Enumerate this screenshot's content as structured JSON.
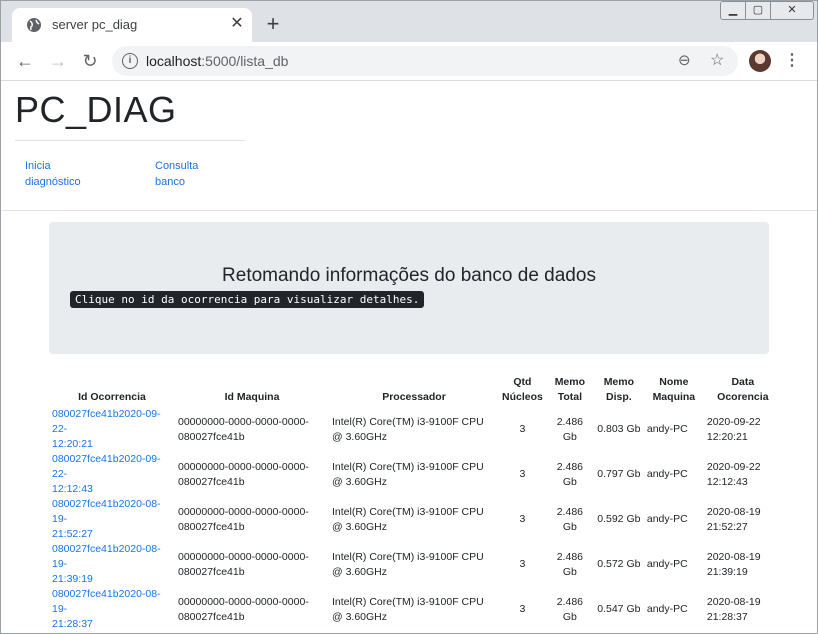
{
  "browser": {
    "tab_title": "server pc_diag",
    "new_tab_label": "+",
    "close_tab_label": "✕",
    "url_host": "localhost",
    "url_path": ":5000/lista_db"
  },
  "header": {
    "brand": "PC_DIAG",
    "nav": [
      {
        "label_1": "Inicia",
        "label_2": "diagnóstico"
      },
      {
        "label_1": "Consulta",
        "label_2": "banco"
      }
    ]
  },
  "jumbotron": {
    "title": "Retomando informações do banco de dados",
    "hint": "Clique no id da ocorrencia para visualizar detalhes."
  },
  "table": {
    "headers": [
      {
        "l1": "Id Ocorrencia",
        "l2": ""
      },
      {
        "l1": "Id Maquina",
        "l2": ""
      },
      {
        "l1": "Processador",
        "l2": ""
      },
      {
        "l1": "Qtd",
        "l2": "Núcleos"
      },
      {
        "l1": "Memo",
        "l2": "Total"
      },
      {
        "l1": "Memo",
        "l2": "Disp."
      },
      {
        "l1": "Nome",
        "l2": "Maquina"
      },
      {
        "l1": "Data",
        "l2": "Ocorencia"
      }
    ],
    "rows": [
      {
        "id1": "080027fce41b2020-09-22-",
        "id2": "12:20:21",
        "maq1": "00000000-0000-0000-0000-",
        "maq2": "080027fce41b",
        "proc1": "Intel(R) Core(TM) i3-9100F CPU",
        "proc2": "@ 3.60GHz",
        "cores": "3",
        "mem_total": "2.486 Gb",
        "mem_disp": "0.803 Gb",
        "nome": "andy-PC",
        "data1": "2020-09-22",
        "data2": "12:20:21"
      },
      {
        "id1": "080027fce41b2020-09-22-",
        "id2": "12:12:43",
        "maq1": "00000000-0000-0000-0000-",
        "maq2": "080027fce41b",
        "proc1": "Intel(R) Core(TM) i3-9100F CPU",
        "proc2": "@ 3.60GHz",
        "cores": "3",
        "mem_total": "2.486 Gb",
        "mem_disp": "0.797 Gb",
        "nome": "andy-PC",
        "data1": "2020-09-22",
        "data2": "12:12:43"
      },
      {
        "id1": "080027fce41b2020-08-19-",
        "id2": "21:52:27",
        "maq1": "00000000-0000-0000-0000-",
        "maq2": "080027fce41b",
        "proc1": "Intel(R) Core(TM) i3-9100F CPU",
        "proc2": "@ 3.60GHz",
        "cores": "3",
        "mem_total": "2.486 Gb",
        "mem_disp": "0.592 Gb",
        "nome": "andy-PC",
        "data1": "2020-08-19",
        "data2": "21:52:27"
      },
      {
        "id1": "080027fce41b2020-08-19-",
        "id2": "21:39:19",
        "maq1": "00000000-0000-0000-0000-",
        "maq2": "080027fce41b",
        "proc1": "Intel(R) Core(TM) i3-9100F CPU",
        "proc2": "@ 3.60GHz",
        "cores": "3",
        "mem_total": "2.486 Gb",
        "mem_disp": "0.572 Gb",
        "nome": "andy-PC",
        "data1": "2020-08-19",
        "data2": "21:39:19"
      },
      {
        "id1": "080027fce41b2020-08-19-",
        "id2": "21:28:37",
        "maq1": "00000000-0000-0000-0000-",
        "maq2": "080027fce41b",
        "proc1": "Intel(R) Core(TM) i3-9100F CPU",
        "proc2": "@ 3.60GHz",
        "cores": "3",
        "mem_total": "2.486 Gb",
        "mem_disp": "0.547 Gb",
        "nome": "andy-PC",
        "data1": "2020-08-19",
        "data2": "21:28:37"
      }
    ]
  }
}
